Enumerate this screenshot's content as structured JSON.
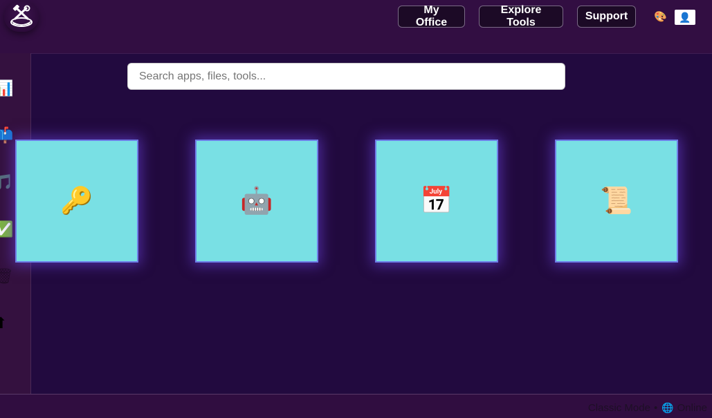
{
  "header": {
    "logo_icon": "tools-nest-logo-icon",
    "nav": {
      "office": "My Office",
      "explore": "Explore Tools",
      "support": "Support"
    },
    "theme_icon_glyph": "🎨",
    "avatar_glyph": "👤"
  },
  "sidebar": {
    "items": [
      {
        "icon": "bar-chart-icon",
        "glyph": "📊"
      },
      {
        "icon": "mailbox-icon",
        "glyph": "📫"
      },
      {
        "icon": "music-note-icon",
        "glyph": "🎵"
      },
      {
        "icon": "check-mark-icon",
        "glyph": "✅"
      },
      {
        "icon": "trash-icon",
        "glyph": "🗑"
      },
      {
        "icon": "up-arrow-icon",
        "glyph": "⬆"
      }
    ]
  },
  "search": {
    "placeholder": "Search apps, files, tools..."
  },
  "tiles": [
    {
      "icon": "key-icon",
      "glyph": "🔑"
    },
    {
      "icon": "robot-icon",
      "glyph": "🤖"
    },
    {
      "icon": "calendar-icon",
      "glyph": "📅"
    },
    {
      "icon": "scroll-icon",
      "glyph": "📜"
    }
  ],
  "footer": {
    "mode": "Classic Mode",
    "separator": "•",
    "globe_glyph": "🌐",
    "status": "Online"
  },
  "colors": {
    "tile_bg": "#79e0e4",
    "main_bg": "#220a3f",
    "header_bg": "#320e42"
  }
}
